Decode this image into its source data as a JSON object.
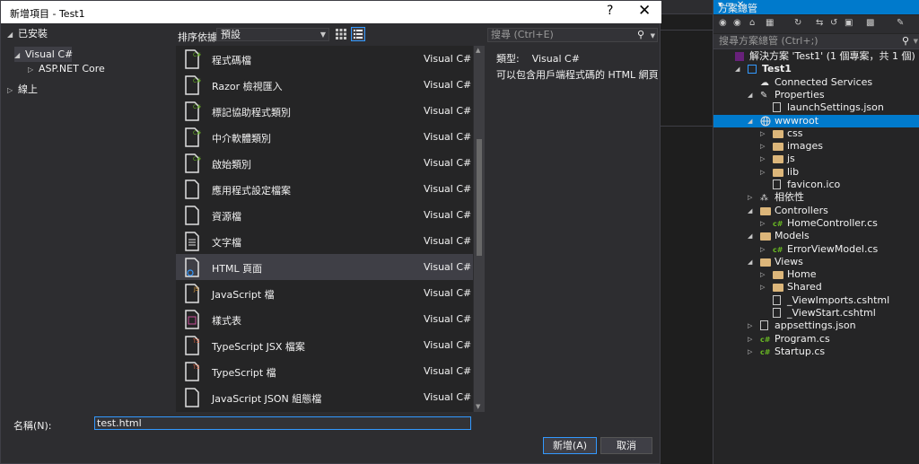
{
  "dialog": {
    "title": "新增項目 - Test1",
    "help": "?",
    "close": "✕"
  },
  "tree": {
    "installed": "已安裝",
    "visual_csharp": "Visual C#",
    "aspnet_core": "ASP.NET Core",
    "online": "線上"
  },
  "toolbar": {
    "sort_label": "排序依據:",
    "sort_value": "預設"
  },
  "search": {
    "placeholder": "搜尋 (Ctrl+E)"
  },
  "templates": [
    {
      "name": "程式碼檔",
      "lang": "Visual C#",
      "icon": "code-file-icon"
    },
    {
      "name": "Razor 檢視匯入",
      "lang": "Visual C#",
      "icon": "razor-import-icon"
    },
    {
      "name": "標記協助程式類別",
      "lang": "Visual C#",
      "icon": "tag-helper-class-icon"
    },
    {
      "name": "中介軟體類別",
      "lang": "Visual C#",
      "icon": "middleware-class-icon"
    },
    {
      "name": "啟始類別",
      "lang": "Visual C#",
      "icon": "startup-class-icon"
    },
    {
      "name": "應用程式設定檔案",
      "lang": "Visual C#",
      "icon": "app-settings-icon"
    },
    {
      "name": "資源檔",
      "lang": "Visual C#",
      "icon": "resource-file-icon"
    },
    {
      "name": "文字檔",
      "lang": "Visual C#",
      "icon": "text-file-icon"
    },
    {
      "name": "HTML 頁面",
      "lang": "Visual C#",
      "icon": "html-page-icon"
    },
    {
      "name": "JavaScript 檔",
      "lang": "Visual C#",
      "icon": "javascript-file-icon"
    },
    {
      "name": "樣式表",
      "lang": "Visual C#",
      "icon": "stylesheet-icon"
    },
    {
      "name": "TypeScript JSX 檔案",
      "lang": "Visual C#",
      "icon": "typescript-jsx-icon"
    },
    {
      "name": "TypeScript 檔",
      "lang": "Visual C#",
      "icon": "typescript-file-icon"
    },
    {
      "name": "JavaScript JSON 組態檔",
      "lang": "Visual C#",
      "icon": "json-config-icon"
    }
  ],
  "selected_index": 8,
  "detail": {
    "type_label": "類型:",
    "type_value": "Visual C#",
    "description": "可以包含用戶端程式碼的 HTML 網頁"
  },
  "bottom": {
    "name_label": "名稱(N):",
    "name_value": "test.html",
    "add_label": "新增(A)",
    "cancel_label": "取消"
  },
  "solution_explorer": {
    "title": "方案總管",
    "search_placeholder": "搜尋方案總管 (Ctrl+;)",
    "items": [
      {
        "label": "解決方案 'Test1' (1 個專案，共 1 個)",
        "depth": 0,
        "arrow": "",
        "icon": "solution-icon"
      },
      {
        "label": "Test1",
        "depth": 1,
        "arrow": "open",
        "icon": "project-icon",
        "bold": true
      },
      {
        "label": "Connected Services",
        "depth": 2,
        "arrow": "",
        "icon": "connected-services-icon"
      },
      {
        "label": "Properties",
        "depth": 2,
        "arrow": "open",
        "icon": "wrench-icon"
      },
      {
        "label": "launchSettings.json",
        "depth": 3,
        "arrow": "",
        "icon": "json-file-icon"
      },
      {
        "label": "wwwroot",
        "depth": 2,
        "arrow": "open",
        "icon": "globe-icon",
        "selected": true
      },
      {
        "label": "css",
        "depth": 3,
        "arrow": "closed",
        "icon": "folder-icon"
      },
      {
        "label": "images",
        "depth": 3,
        "arrow": "closed",
        "icon": "folder-icon"
      },
      {
        "label": "js",
        "depth": 3,
        "arrow": "closed",
        "icon": "folder-icon"
      },
      {
        "label": "lib",
        "depth": 3,
        "arrow": "closed",
        "icon": "folder-icon"
      },
      {
        "label": "favicon.ico",
        "depth": 3,
        "arrow": "",
        "icon": "file-icon"
      },
      {
        "label": "相依性",
        "depth": 2,
        "arrow": "closed",
        "icon": "dependencies-icon"
      },
      {
        "label": "Controllers",
        "depth": 2,
        "arrow": "open",
        "icon": "folder-icon"
      },
      {
        "label": "HomeController.cs",
        "depth": 3,
        "arrow": "closed",
        "icon": "csharp-file-icon"
      },
      {
        "label": "Models",
        "depth": 2,
        "arrow": "open",
        "icon": "folder-icon"
      },
      {
        "label": "ErrorViewModel.cs",
        "depth": 3,
        "arrow": "closed",
        "icon": "csharp-file-icon"
      },
      {
        "label": "Views",
        "depth": 2,
        "arrow": "open",
        "icon": "folder-icon"
      },
      {
        "label": "Home",
        "depth": 3,
        "arrow": "closed",
        "icon": "folder-icon"
      },
      {
        "label": "Shared",
        "depth": 3,
        "arrow": "closed",
        "icon": "folder-icon"
      },
      {
        "label": "_ViewImports.cshtml",
        "depth": 3,
        "arrow": "",
        "icon": "cshtml-file-icon"
      },
      {
        "label": "_ViewStart.cshtml",
        "depth": 3,
        "arrow": "",
        "icon": "cshtml-file-icon"
      },
      {
        "label": "appsettings.json",
        "depth": 2,
        "arrow": "closed",
        "icon": "json-file-icon"
      },
      {
        "label": "Program.cs",
        "depth": 2,
        "arrow": "closed",
        "icon": "csharp-file-icon"
      },
      {
        "label": "Startup.cs",
        "depth": 2,
        "arrow": "closed",
        "icon": "csharp-file-icon"
      }
    ]
  }
}
